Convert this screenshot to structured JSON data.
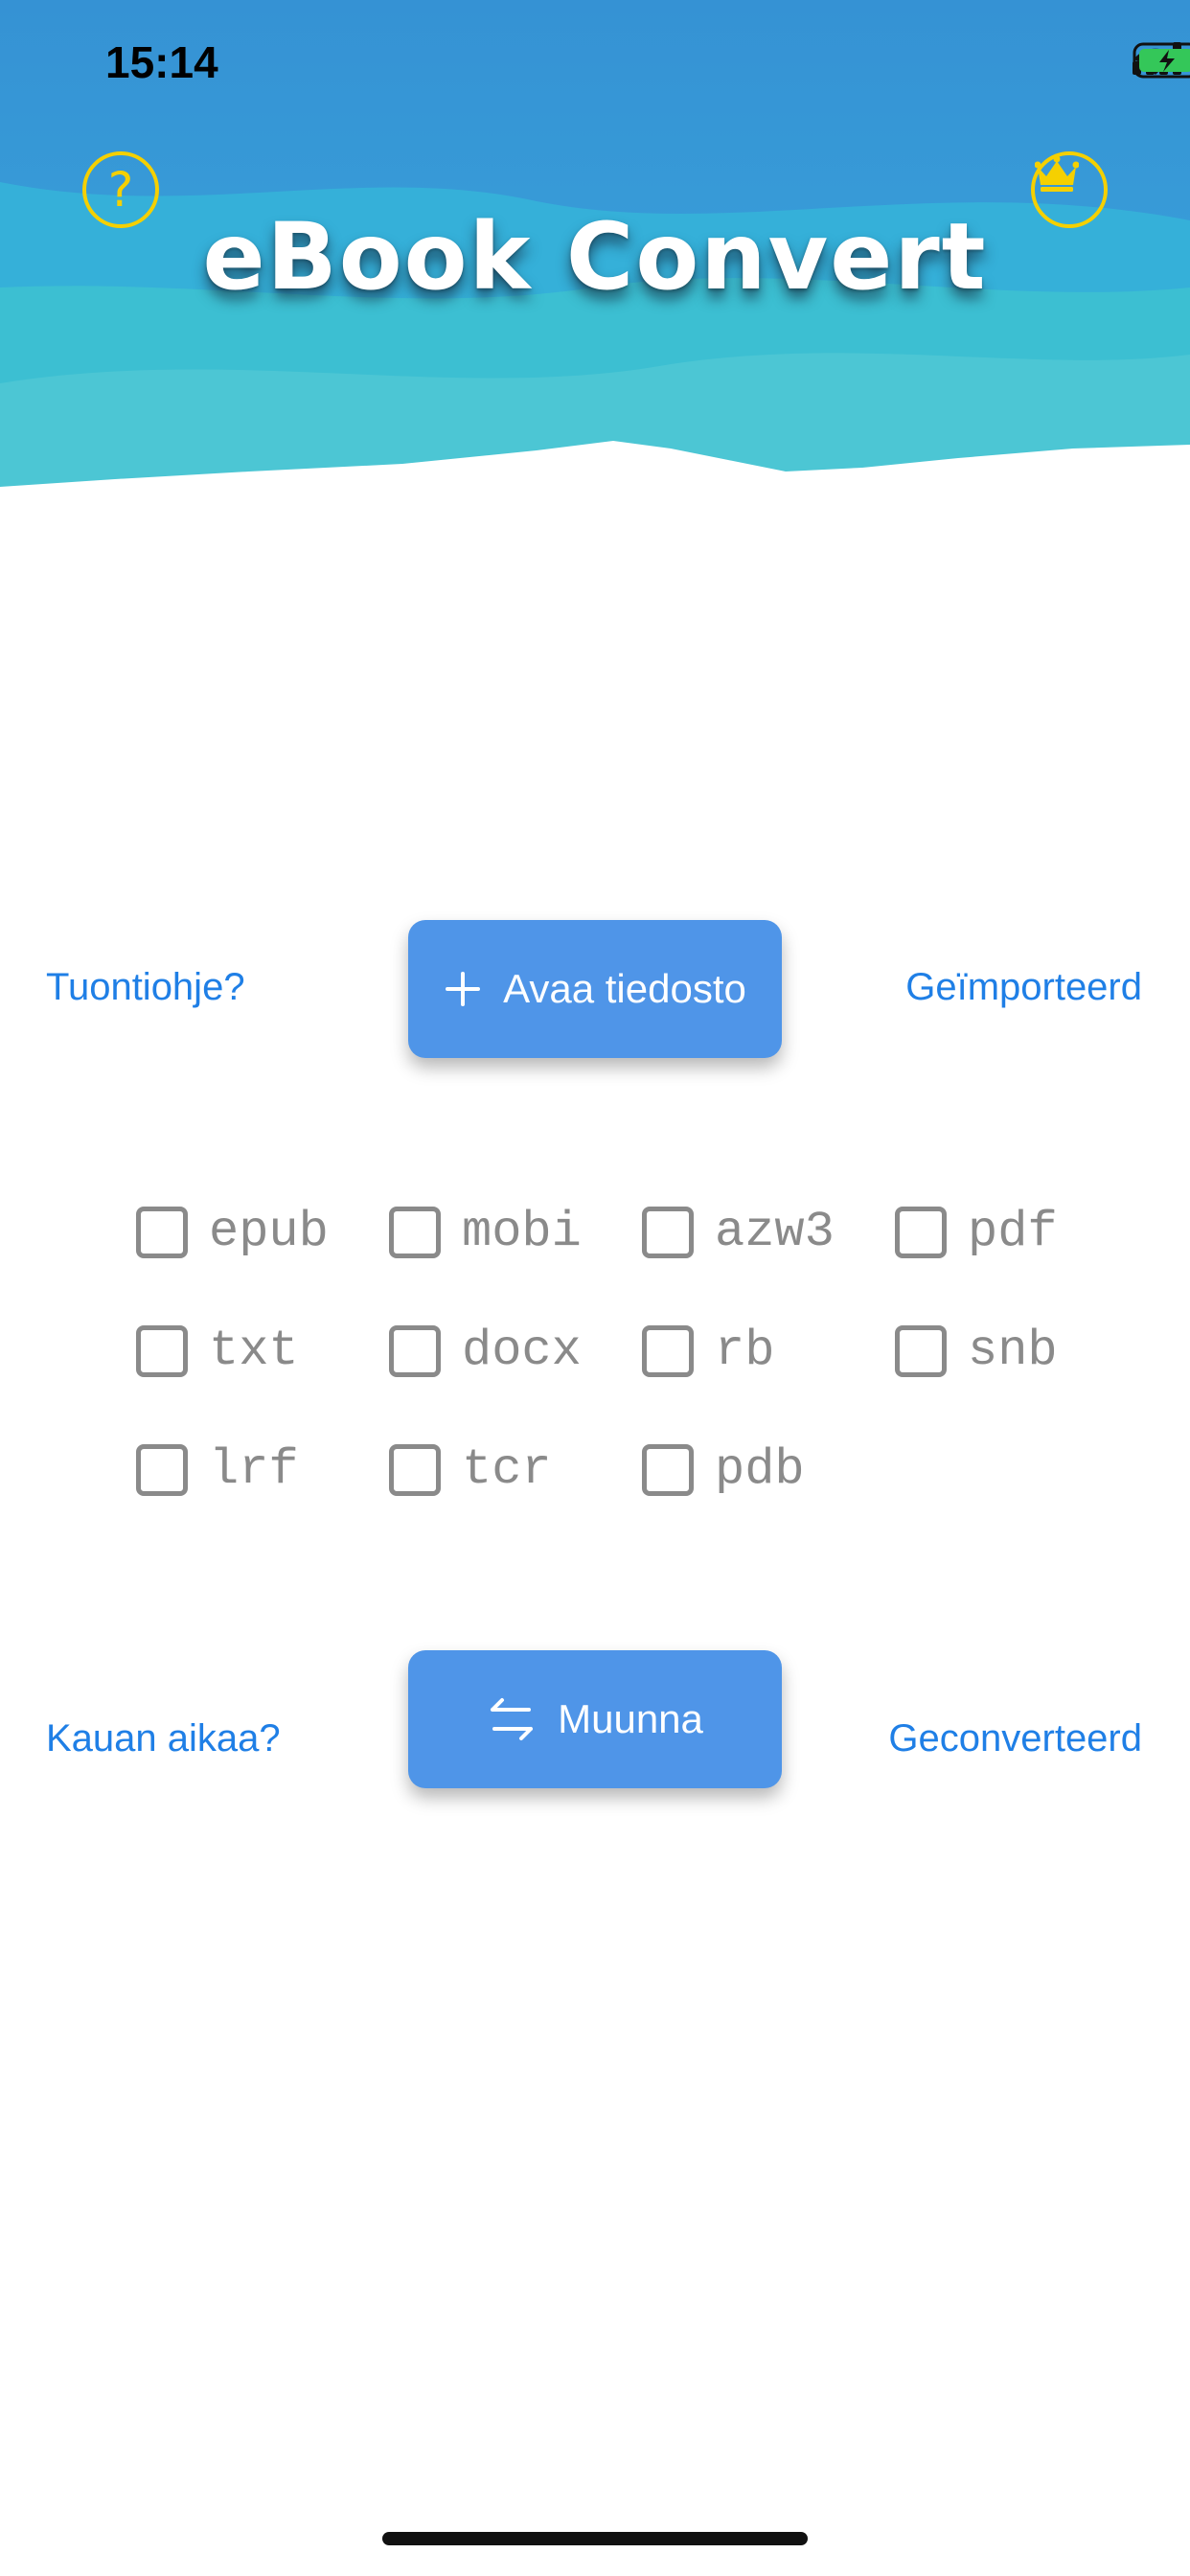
{
  "status_bar": {
    "time": "15:14"
  },
  "header": {
    "title": "eBook Convert",
    "help_symbol": "?"
  },
  "import": {
    "help_link": "Tuontiohje?",
    "open_button_label": "Avaa tiedosto",
    "imported_link": "Geïmporteerd"
  },
  "formats": [
    "epub",
    "mobi",
    "azw3",
    "pdf",
    "txt",
    "docx",
    "rb",
    "snb",
    "lrf",
    "tcr",
    "pdb"
  ],
  "convert": {
    "time_link": "Kauan aikaa?",
    "convert_button_label": "Muunna",
    "converted_link": "Geconverteerd"
  },
  "colors": {
    "header_blue": "#3a9ad6",
    "header_teal": "#3cbfd2",
    "accent_yellow": "#f5d000",
    "button_blue": "#4f95e8",
    "link_blue": "#1f7fe6",
    "checkbox_gray": "#8a8a8a"
  },
  "icons": [
    "help-icon",
    "crown-icon",
    "plus-icon",
    "swap-arrows-icon",
    "signal-icon",
    "wifi-icon",
    "battery-icon"
  ]
}
